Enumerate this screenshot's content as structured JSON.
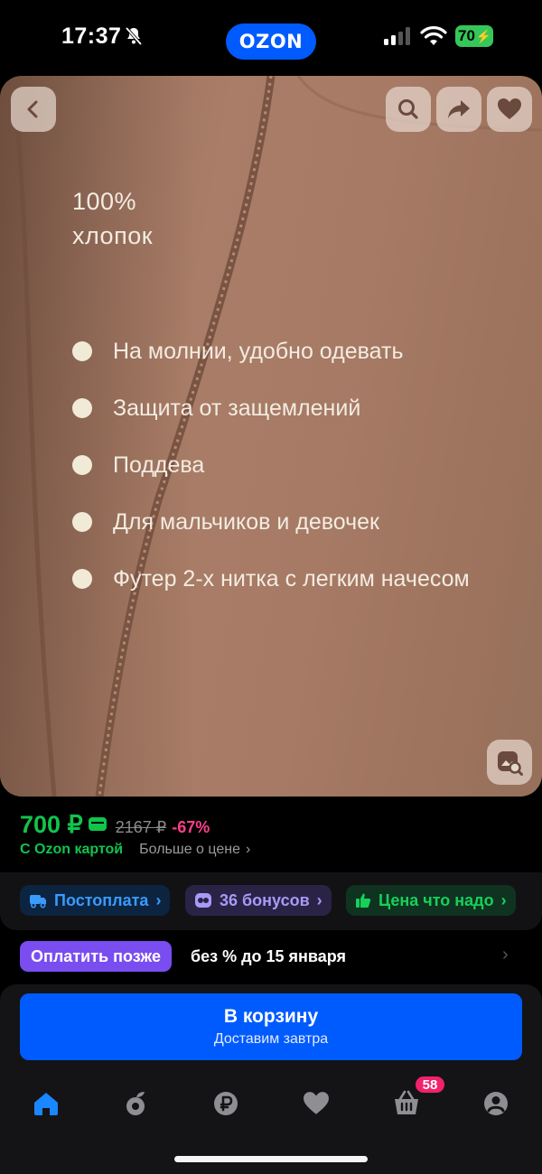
{
  "status_bar": {
    "time": "17:37",
    "battery": "70",
    "icons": [
      "bell-slash-icon",
      "cellular-signal-icon",
      "wifi-icon",
      "battery-icon"
    ]
  },
  "header": {
    "logo": "OZON"
  },
  "hero": {
    "heading_line1": "100%",
    "heading_line2": "хлопок",
    "features": [
      "На молнии, удобно одевать",
      "Защита от защемлений",
      "Поддева",
      "Для мальчиков и девочек",
      "Футер 2-х нитка с легким начесом"
    ],
    "buttons": [
      "chevron-left-icon",
      "search-icon",
      "share-icon",
      "heart-icon",
      "similar-search-icon"
    ]
  },
  "price": {
    "current": "700 ₽",
    "old": "2167 ₽",
    "discount": "-67%",
    "ozon_card_label": "С Ozon картой",
    "more_label": "Больше о цене"
  },
  "chips": [
    {
      "label": "Постоплата",
      "icon": "truck-icon"
    },
    {
      "label": "36 бонусов",
      "icon": "bonus-icon"
    },
    {
      "label": "Цена что надо",
      "icon": "thumbs-up-icon"
    }
  ],
  "pay_later": {
    "badge": "Оплатить позже",
    "text": "без % до 15 января"
  },
  "cart_button": {
    "title": "В корзину",
    "subtitle": "Доставим завтра"
  },
  "tabbar": {
    "items": [
      "home-icon",
      "fresh-icon",
      "finance-icon",
      "favorites-icon",
      "cart-icon",
      "profile-icon"
    ],
    "cart_count": "58"
  },
  "colors": {
    "brand_blue": "#005bff",
    "price_green": "#10c44c",
    "discount_pink": "#ff3d8b",
    "badge_pink": "#f2216c",
    "paylater_purple": "#7a4df0"
  }
}
